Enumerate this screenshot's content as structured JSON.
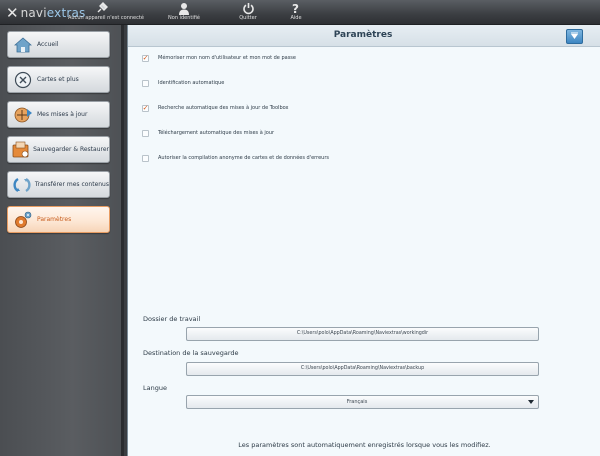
{
  "app": {
    "logo_mark": "✕",
    "logo_text_a": "navi",
    "logo_text_b": "extras"
  },
  "topbar": {
    "items": [
      {
        "label": "Aucun appareil n'est connecté",
        "icon": "device-plug-icon"
      },
      {
        "label": "Non identifié",
        "icon": "user-icon"
      },
      {
        "label": "Quitter",
        "icon": "power-icon"
      },
      {
        "label": "Aide",
        "icon": "help-icon"
      }
    ]
  },
  "sidebar": {
    "items": [
      {
        "label": "Accueil",
        "icon": "home-icon",
        "active": false
      },
      {
        "label": "Cartes et plus",
        "icon": "map-icon",
        "active": false
      },
      {
        "label": "Mes mises à jour",
        "icon": "updates-icon",
        "active": false
      },
      {
        "label": "Sauvegarder & Restaurer",
        "icon": "backup-icon",
        "active": false
      },
      {
        "label": "Transférer mes contenus",
        "icon": "transfer-icon",
        "active": false
      },
      {
        "label": "Paramètres",
        "icon": "settings-icon",
        "active": true
      }
    ]
  },
  "main": {
    "title": "Paramètres",
    "help_icon": "help-arrow-icon",
    "options": [
      {
        "label": "Mémoriser mon nom d'utilisateur et mon mot de passe",
        "checked": true
      },
      {
        "label": "Identification automatique",
        "checked": false
      },
      {
        "label": "Recherche automatique des mises à jour de Toolbox",
        "checked": true
      },
      {
        "label": "Téléchargement automatique des mises à jour",
        "checked": false
      },
      {
        "label": "Autoriser la compilation anonyme de cartes et de données d'erreurs",
        "checked": false
      }
    ],
    "work_folder": {
      "label": "Dossier de travail",
      "value": "C:\\Users\\polo\\AppData\\Roaming\\Naviextras\\workingdir"
    },
    "backup_dest": {
      "label": "Destination de la sauvegarde",
      "value": "C:\\Users\\polo\\AppData\\Roaming\\Naviextras\\backup"
    },
    "language": {
      "label": "Langue",
      "value": "Français"
    },
    "footer": "Les paramètres sont automatiquement enregistrés lorsque vous les modifiez."
  },
  "colors": {
    "accent": "#d45d1f",
    "active_bg": "#fde8d6",
    "panel_bg": "#f3f9fc",
    "title": "#2e4456"
  }
}
